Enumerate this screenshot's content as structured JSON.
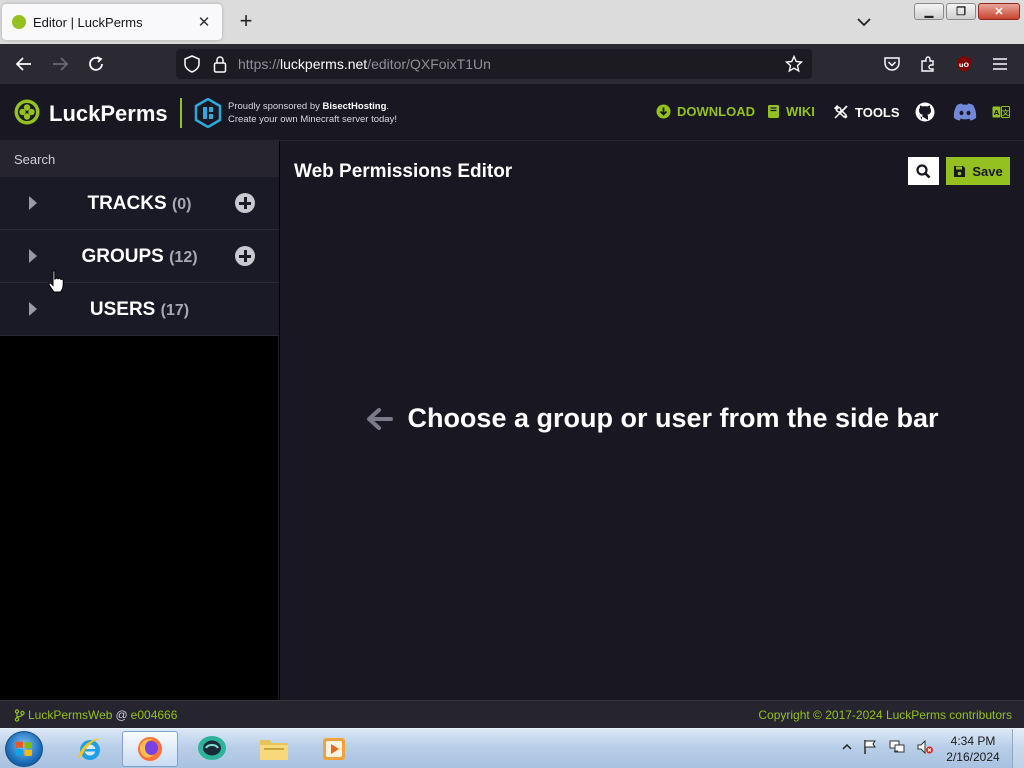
{
  "browser": {
    "tab_title": "Editor | LuckPerms",
    "url_prefix": "https://",
    "url_host": "luckperms.net",
    "url_path": "/editor/QXFoixT1Un",
    "new_tab": "+",
    "close_tab": "✕"
  },
  "header": {
    "brand": "LuckPerms",
    "sponsor_line1_prefix": "Proudly sponsored by ",
    "sponsor_name": "BisectHosting",
    "sponsor_line1_suffix": ".",
    "sponsor_line2": "Create your own Minecraft server today!",
    "nav": {
      "download": "DOWNLOAD",
      "wiki": "WIKI",
      "tools": "TOOLS"
    },
    "accent_color": "#94c11f"
  },
  "sidebar": {
    "search_placeholder": "Search",
    "items": [
      {
        "label": "TRACKS",
        "count": "(0)"
      },
      {
        "label": "GROUPS",
        "count": "(12)"
      },
      {
        "label": "USERS",
        "count": "(17)"
      }
    ]
  },
  "main": {
    "title": "Web Permissions Editor",
    "save_label": "Save",
    "empty_message": "Choose a group or user from the side bar"
  },
  "footer": {
    "project": "LuckPermsWeb",
    "at": "@",
    "commit": "e004666",
    "copyright": "Copyright © 2017-2024 LuckPerms contributors"
  },
  "taskbar": {
    "time": "4:34 PM",
    "date": "2/16/2024"
  }
}
